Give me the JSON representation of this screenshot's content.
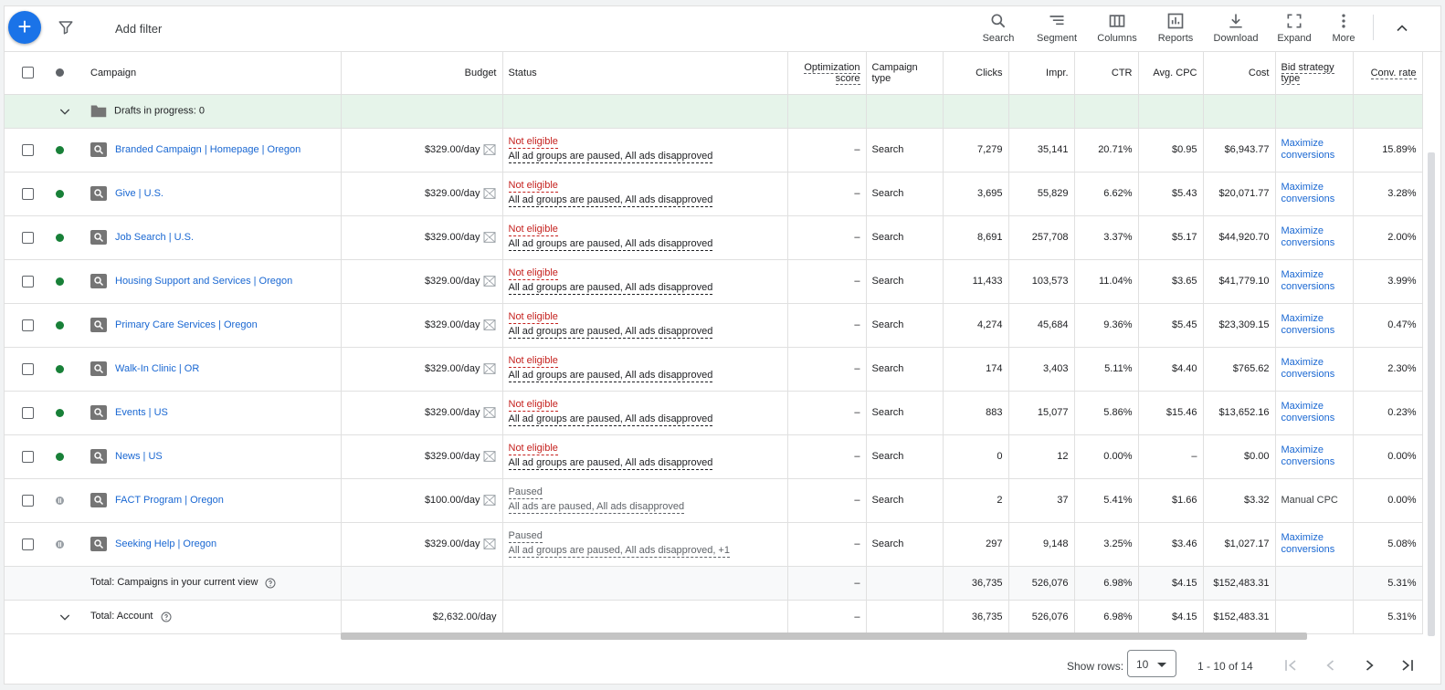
{
  "toolbar": {
    "add_filter": "Add filter",
    "tools": [
      {
        "label": "Search",
        "icon": "search-icon"
      },
      {
        "label": "Segment",
        "icon": "segment-icon"
      },
      {
        "label": "Columns",
        "icon": "columns-icon"
      },
      {
        "label": "Reports",
        "icon": "reports-icon"
      },
      {
        "label": "Download",
        "icon": "download-icon"
      },
      {
        "label": "Expand",
        "icon": "expand-icon"
      },
      {
        "label": "More",
        "icon": "more-vert-icon"
      }
    ]
  },
  "headers": {
    "campaign": "Campaign",
    "budget": "Budget",
    "status": "Status",
    "opt_score_1": "Optimization",
    "opt_score_2": "score",
    "campaign_type_1": "Campaign",
    "campaign_type_2": "type",
    "clicks": "Clicks",
    "impr": "Impr.",
    "ctr": "CTR",
    "avg_cpc": "Avg. CPC",
    "cost": "Cost",
    "bid_strategy_1": "Bid strategy",
    "bid_strategy_2": "type",
    "conv_rate": "Conv. rate"
  },
  "drafts": "Drafts in progress: 0",
  "rows": [
    {
      "name": "Branded Campaign | Homepage | Oregon",
      "budget": "$329.00/day",
      "status": "Not eligible",
      "reason": "All ad groups are paused, All ads disapproved",
      "opt": "–",
      "type": "Search",
      "clicks": "7,279",
      "impr": "35,141",
      "ctr": "20.71%",
      "cpc": "$0.95",
      "cost": "$6,943.77",
      "bid": "Maximize conversions",
      "conv": "15.89%",
      "state": "enabled"
    },
    {
      "name": "Give | U.S.",
      "budget": "$329.00/day",
      "status": "Not eligible",
      "reason": "All ad groups are paused, All ads disapproved",
      "opt": "–",
      "type": "Search",
      "clicks": "3,695",
      "impr": "55,829",
      "ctr": "6.62%",
      "cpc": "$5.43",
      "cost": "$20,071.77",
      "bid": "Maximize conversions",
      "conv": "3.28%",
      "state": "enabled"
    },
    {
      "name": "Job Search | U.S.",
      "budget": "$329.00/day",
      "status": "Not eligible",
      "reason": "All ad groups are paused, All ads disapproved",
      "opt": "–",
      "type": "Search",
      "clicks": "8,691",
      "impr": "257,708",
      "ctr": "3.37%",
      "cpc": "$5.17",
      "cost": "$44,920.70",
      "bid": "Maximize conversions",
      "conv": "2.00%",
      "state": "enabled"
    },
    {
      "name": "Housing Support and Services | Oregon",
      "budget": "$329.00/day",
      "status": "Not eligible",
      "reason": "All ad groups are paused, All ads disapproved",
      "opt": "–",
      "type": "Search",
      "clicks": "11,433",
      "impr": "103,573",
      "ctr": "11.04%",
      "cpc": "$3.65",
      "cost": "$41,779.10",
      "bid": "Maximize conversions",
      "conv": "3.99%",
      "state": "enabled"
    },
    {
      "name": "Primary Care Services | Oregon",
      "budget": "$329.00/day",
      "status": "Not eligible",
      "reason": "All ad groups are paused, All ads disapproved",
      "opt": "–",
      "type": "Search",
      "clicks": "4,274",
      "impr": "45,684",
      "ctr": "9.36%",
      "cpc": "$5.45",
      "cost": "$23,309.15",
      "bid": "Maximize conversions",
      "conv": "0.47%",
      "state": "enabled"
    },
    {
      "name": "Walk-In Clinic | OR",
      "budget": "$329.00/day",
      "status": "Not eligible",
      "reason": "All ad groups are paused, All ads disapproved",
      "opt": "–",
      "type": "Search",
      "clicks": "174",
      "impr": "3,403",
      "ctr": "5.11%",
      "cpc": "$4.40",
      "cost": "$765.62",
      "bid": "Maximize conversions",
      "conv": "2.30%",
      "state": "enabled"
    },
    {
      "name": "Events | US",
      "budget": "$329.00/day",
      "status": "Not eligible",
      "reason": "All ad groups are paused, All ads disapproved",
      "opt": "–",
      "type": "Search",
      "clicks": "883",
      "impr": "15,077",
      "ctr": "5.86%",
      "cpc": "$15.46",
      "cost": "$13,652.16",
      "bid": "Maximize conversions",
      "conv": "0.23%",
      "state": "enabled"
    },
    {
      "name": "News | US",
      "budget": "$329.00/day",
      "status": "Not eligible",
      "reason": "All ad groups are paused, All ads disapproved",
      "opt": "–",
      "type": "Search",
      "clicks": "0",
      "impr": "12",
      "ctr": "0.00%",
      "cpc": "–",
      "cost": "$0.00",
      "bid": "Maximize conversions",
      "conv": "0.00%",
      "state": "enabled"
    },
    {
      "name": "FACT Program | Oregon",
      "budget": "$100.00/day",
      "status": "Paused",
      "reason": "All ads are paused, All ads disapproved",
      "opt": "–",
      "type": "Search",
      "clicks": "2",
      "impr": "37",
      "ctr": "5.41%",
      "cpc": "$1.66",
      "cost": "$3.32",
      "bid": "Manual CPC",
      "conv": "0.00%",
      "state": "paused"
    },
    {
      "name": "Seeking Help | Oregon",
      "budget": "$329.00/day",
      "status": "Paused",
      "reason": "All ad groups are paused, All ads disapproved, +1",
      "opt": "–",
      "type": "Search",
      "clicks": "297",
      "impr": "9,148",
      "ctr": "3.25%",
      "cpc": "$3.46",
      "cost": "$1,027.17",
      "bid": "Maximize conversions",
      "conv": "5.08%",
      "state": "paused"
    }
  ],
  "total_view": {
    "label": "Total: Campaigns in your current view",
    "opt": "–",
    "clicks": "36,735",
    "impr": "526,076",
    "ctr": "6.98%",
    "cpc": "$4.15",
    "cost": "$152,483.31",
    "conv": "5.31%"
  },
  "total_account": {
    "label": "Total: Account",
    "budget": "$2,632.00/day",
    "opt": "–",
    "clicks": "36,735",
    "impr": "526,076",
    "ctr": "6.98%",
    "cpc": "$4.15",
    "cost": "$152,483.31",
    "conv": "5.31%"
  },
  "footer": {
    "show_rows": "Show rows:",
    "rows_value": "10",
    "range": "1 - 10 of 14"
  },
  "colors": {
    "accent": "#1a73e8",
    "link": "#1967d2",
    "error": "#c5221f",
    "enabled": "#188038",
    "drafts_bg": "#e6f4ea"
  }
}
